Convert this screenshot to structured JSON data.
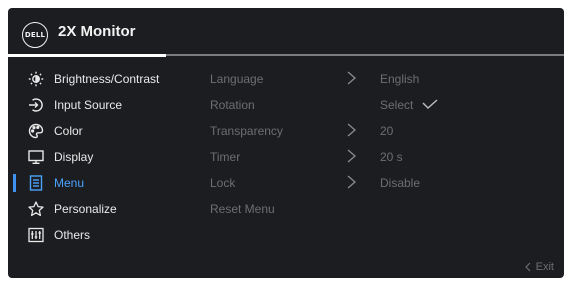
{
  "header": {
    "logo_text": "DELL",
    "title": "2X Monitor"
  },
  "sidebar": {
    "items": [
      {
        "label": "Brightness/Contrast",
        "icon": "brightness-icon"
      },
      {
        "label": "Input Source",
        "icon": "input-source-icon"
      },
      {
        "label": "Color",
        "icon": "color-palette-icon"
      },
      {
        "label": "Display",
        "icon": "display-icon"
      },
      {
        "label": "Menu",
        "icon": "menu-icon",
        "active": true
      },
      {
        "label": "Personalize",
        "icon": "star-icon"
      },
      {
        "label": "Others",
        "icon": "others-icon"
      }
    ]
  },
  "menu_settings": {
    "rows": [
      {
        "label": "Language",
        "value": "English"
      },
      {
        "label": "Rotation",
        "value": "Select"
      },
      {
        "label": "Transparency",
        "value": "20"
      },
      {
        "label": "Timer",
        "value": "20 s"
      },
      {
        "label": "Lock",
        "value": "Disable"
      },
      {
        "label": "Reset Menu",
        "value": ""
      }
    ]
  },
  "footer": {
    "exit_label": "Exit"
  },
  "colors": {
    "background": "#1c1d20",
    "accent": "#3f93f5",
    "text": "#e9e9ea",
    "muted": "#6d6e72"
  }
}
